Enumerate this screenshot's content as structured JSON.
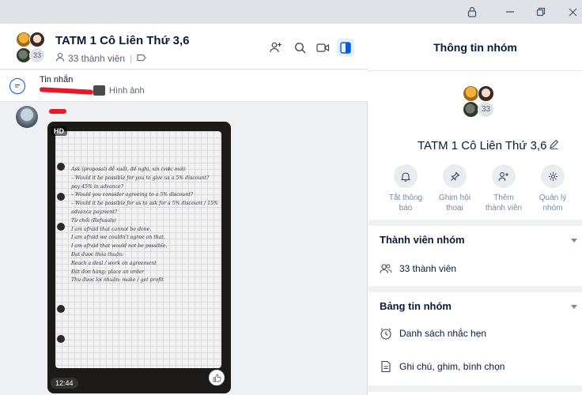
{
  "chat": {
    "group_name": "TATM 1 Cô Liên Thứ 3,6",
    "member_count_badge": "33",
    "members_label": "33 thành viên",
    "pinned": {
      "title": "Tin nhắn",
      "attachment_label": "Hình ảnh"
    },
    "message": {
      "hd_badge": "HD",
      "time": "12:44",
      "note_lines": [
        "Ask (proposal) đề xuất, đề nghị, xin (việc mới)",
        "– Would it be possible for you to give us a 5% discount?",
        "  pay 45% in advance?",
        "– Would you consider agreeing to a 5% discount?",
        "– Would it be possible for us to ask for a 5% discount / 15%",
        "  advance payment?",
        "Từ chối (Refusals)",
        "  I am afraid that cannot be done.",
        "  I am afraid we couldn't agree on that.",
        "  I am afraid that would not be possible.",
        "  Đạt được thỏa thuận:",
        "  Reach a deal / work on agreement",
        "  Đặt đơn hàng: place an order",
        "  Thu được lợi nhuận: make / get profit"
      ]
    }
  },
  "info": {
    "header_title": "Thông tin nhóm",
    "group_name": "TATM 1 Cô Liên Thứ 3,6",
    "member_count_badge": "33",
    "actions": [
      {
        "line1": "Tắt thông",
        "line2": "báo",
        "icon": "bell-icon"
      },
      {
        "line1": "Ghim hội",
        "line2": "thoại",
        "icon": "pin-icon"
      },
      {
        "line1": "Thêm",
        "line2": "thành viên",
        "icon": "add-member-icon"
      },
      {
        "line1": "Quản lý",
        "line2": "nhóm",
        "icon": "gear-icon"
      }
    ],
    "members_section": {
      "title": "Thành viên nhóm",
      "count_label": "33 thành viên"
    },
    "board_section": {
      "title": "Bảng tin nhóm",
      "reminders_label": "Danh sách nhắc hẹn",
      "notes_label": "Ghi chú, ghim, bình chọn"
    }
  },
  "colors": {
    "accent": "#005ae0",
    "redaction": "#e8182a",
    "titlebar": "#dfe2e7",
    "chat_bg": "#eef0f1"
  }
}
